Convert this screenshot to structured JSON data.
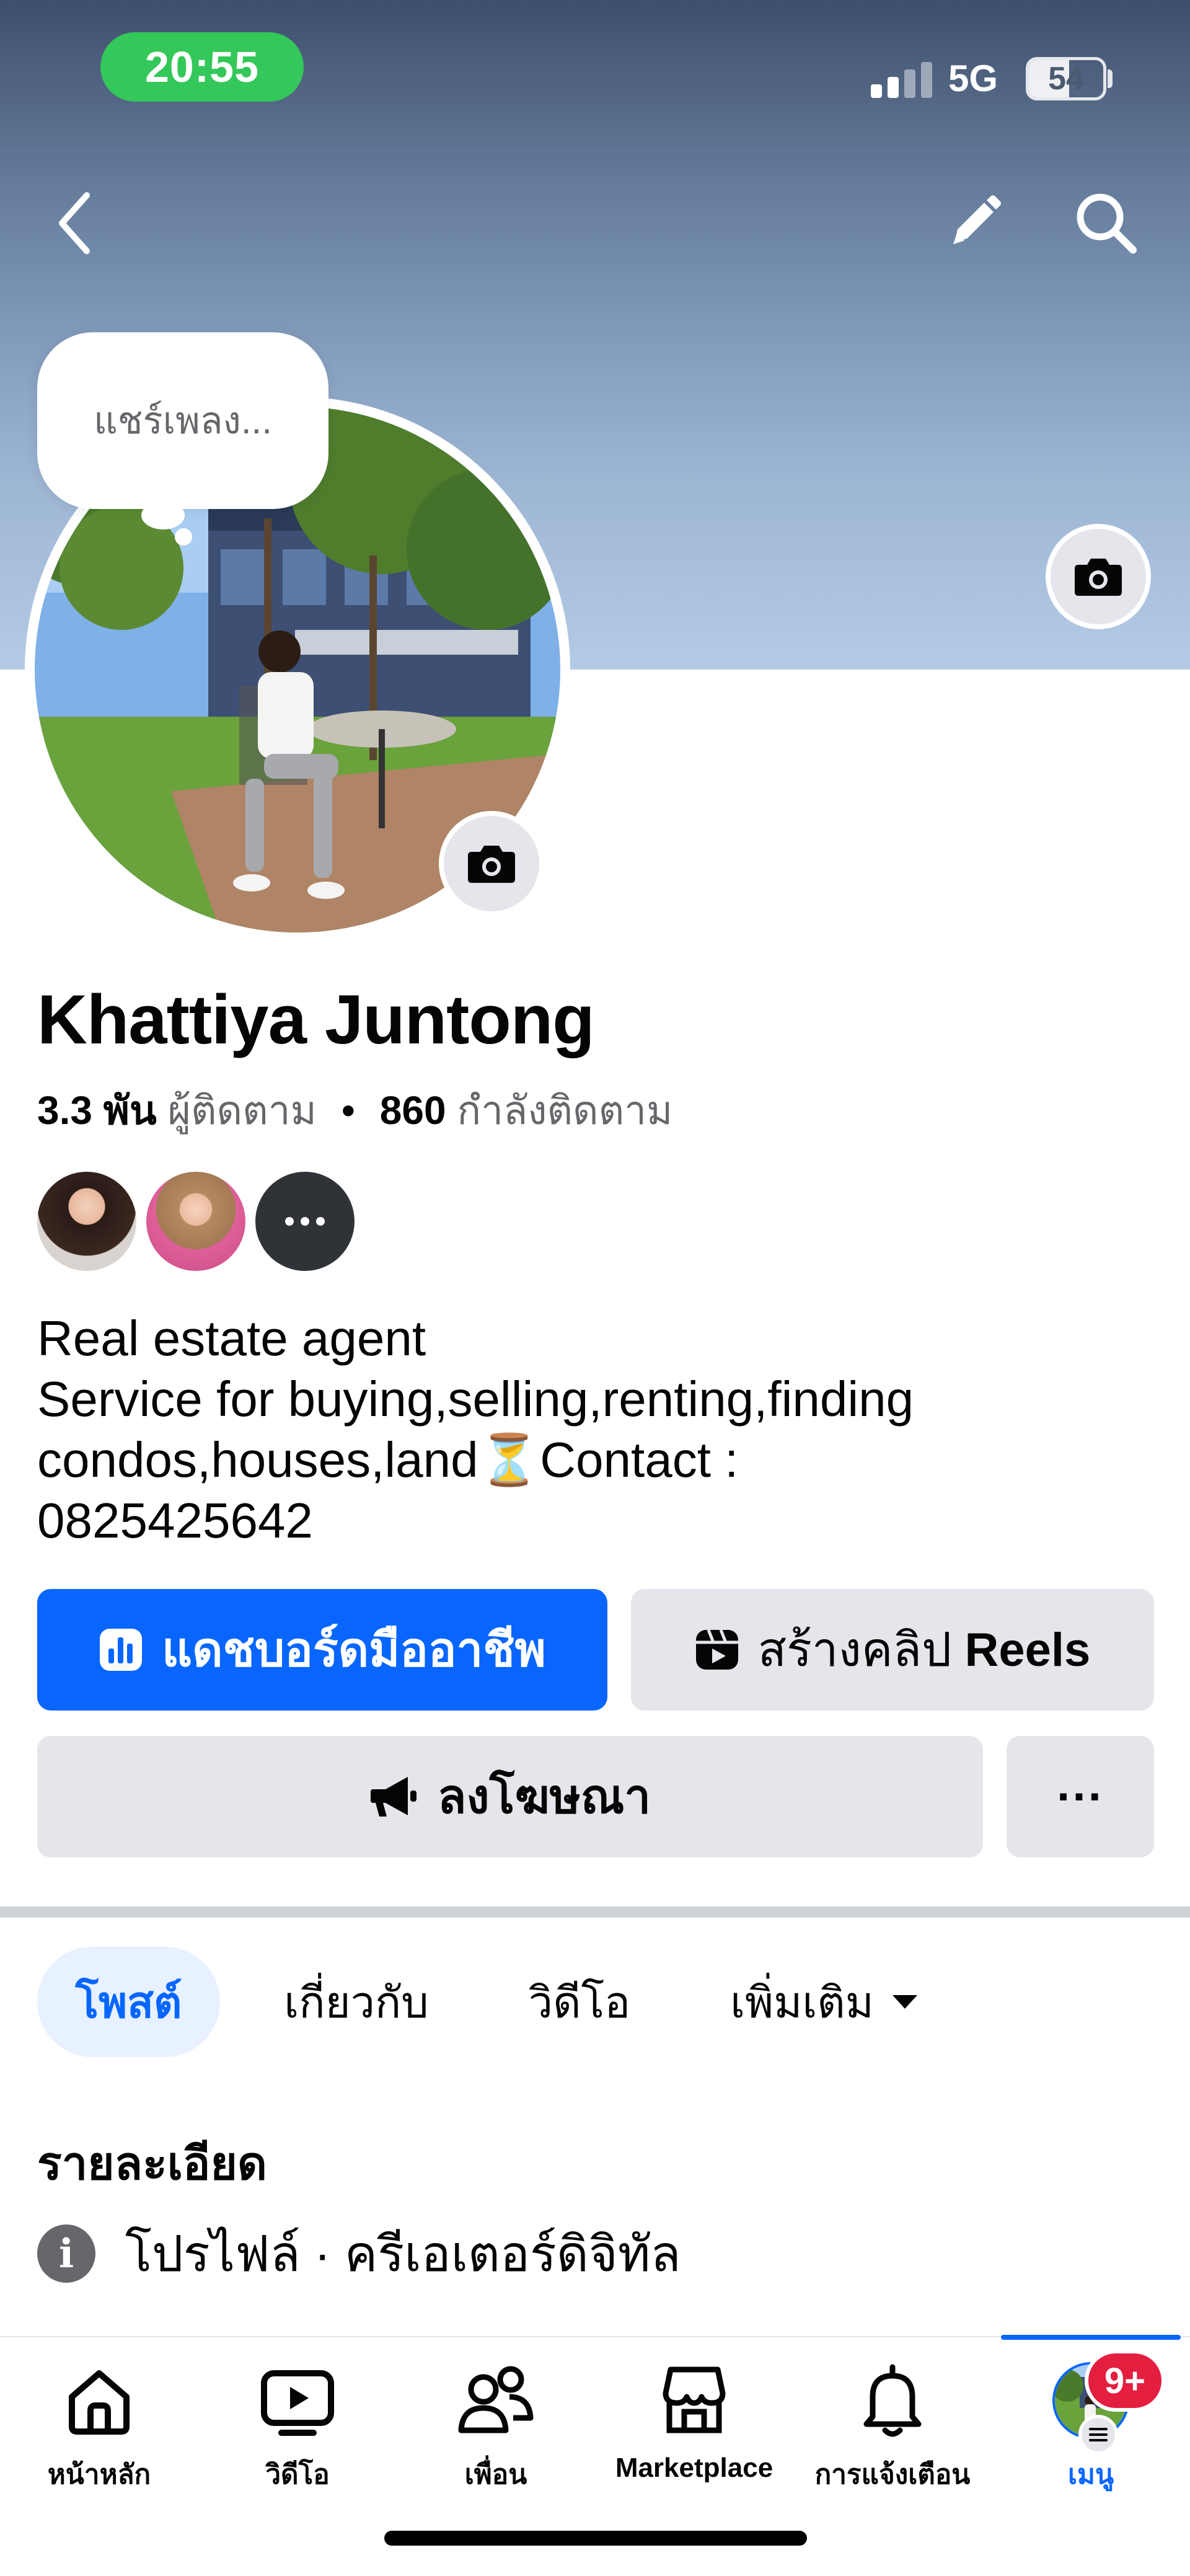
{
  "status_bar": {
    "time": "20:55",
    "network": "5G",
    "battery": "54",
    "battery_fraction": 0.54
  },
  "header": {
    "back_icon": "chevron-left-icon",
    "edit_icon": "pencil-icon",
    "search_icon": "search-icon"
  },
  "profile": {
    "note_bubble": "แชร์เพลง...",
    "name": "Khattiya Juntong",
    "followers_count": "3.3 พัน",
    "followers_label": "ผู้ติดตาม",
    "separator": "•",
    "following_count": "860",
    "following_label": "กำลังติดตาม",
    "bio_lines": [
      "Real estate agent",
      "Service for buying,selling,renting,finding",
      "condos,houses,land⏳Contact :",
      "0825425642"
    ]
  },
  "actions": {
    "dashboard": "แดชบอร์ดมืออาชีพ",
    "reels_prefix": "สร้างคลิป ",
    "reels_suffix": "Reels",
    "advertise": "ลงโฆษณา",
    "more": "···"
  },
  "tabs": [
    {
      "label": "โพสต์",
      "active": true
    },
    {
      "label": "เกี่ยวกับ",
      "active": false
    },
    {
      "label": "วิดีโอ",
      "active": false
    },
    {
      "label": "เพิ่มเติม",
      "active": false
    }
  ],
  "details": {
    "title": "รายละเอียด",
    "profile_line": "โปรไฟล์ · ครีเอเตอร์ดิจิทัล"
  },
  "bottom_nav": {
    "items": [
      {
        "label": "หน้าหลัก",
        "icon": "home-icon"
      },
      {
        "label": "วิดีโอ",
        "icon": "video-icon"
      },
      {
        "label": "เพื่อน",
        "icon": "friends-icon"
      },
      {
        "label": "Marketplace",
        "icon": "marketplace-icon"
      },
      {
        "label": "การแจ้งเตือน",
        "icon": "bell-icon"
      },
      {
        "label": "เมนู",
        "icon": "menu-avatar-icon",
        "active": true
      }
    ],
    "badge": "9+"
  },
  "colors": {
    "accent": "#0866ff",
    "badge": "#e41e3f",
    "status_green": "#34c759"
  }
}
